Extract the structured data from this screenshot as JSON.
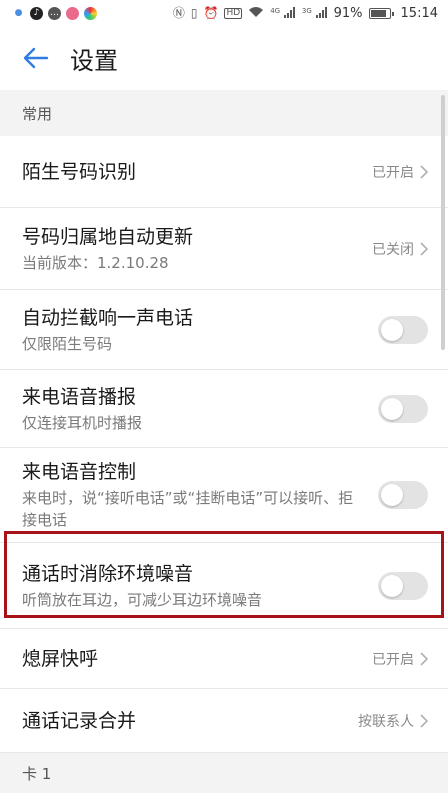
{
  "status_bar": {
    "battery": "91%",
    "time": "15:14",
    "hd_label": "HD",
    "network_labels": [
      "4G",
      "3G"
    ],
    "battery_level": 0.91
  },
  "header": {
    "title": "设置"
  },
  "sections": [
    {
      "label": "常用"
    },
    {
      "label": "卡 1"
    }
  ],
  "rows": {
    "stranger": {
      "title": "陌生号码识别",
      "value": "已开启"
    },
    "location": {
      "title": "号码归属地自动更新",
      "subtitle": "当前版本：1.2.10.28",
      "value": "已关闭"
    },
    "block": {
      "title": "自动拦截响一声电话",
      "subtitle": "仅限陌生号码",
      "toggle": "off"
    },
    "announce": {
      "title": "来电语音播报",
      "subtitle": "仅连接耳机时播报",
      "toggle": "off"
    },
    "voice_ctrl": {
      "title": "来电语音控制",
      "subtitle": "来电时，说“接听电话”或“挂断电话”可以接听、拒接电话",
      "toggle": "off"
    },
    "noise": {
      "title": "通话时消除环境噪音",
      "subtitle": "听筒放在耳边，可减少耳边环境噪音",
      "toggle": "off"
    },
    "pocket": {
      "title": "熄屏快呼",
      "value": "已开启"
    },
    "merge": {
      "title": "通话记录合并",
      "value": "按联系人"
    }
  },
  "colors": {
    "accent": "#2f7de1",
    "highlight": "#a8131a",
    "section_bg": "#f3f3f3"
  }
}
